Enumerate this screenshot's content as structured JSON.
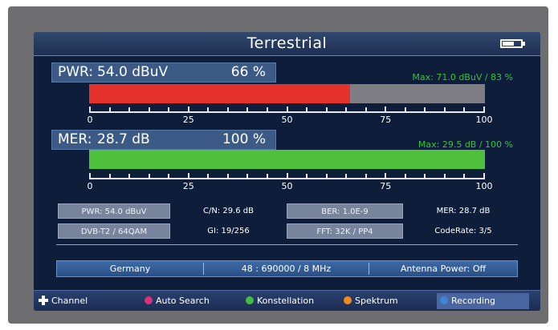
{
  "screen": {
    "title": "Terrestrial"
  },
  "meters": {
    "pwr": {
      "label": "PWR:",
      "value": "54.0 dBuV",
      "percent_text": "66 %",
      "fill_fraction": 0.66,
      "fill_color": "#e4312b",
      "max_text": "Max: 71.0 dBuV / 83 %"
    },
    "mer": {
      "label": "MER:",
      "value": "28.7 dB",
      "percent_text": "100 %",
      "fill_fraction": 1.0,
      "fill_color": "#4ec03c",
      "max_text": "Max: 29.5 dB / 100 %"
    },
    "scale_labels": [
      "0",
      "25",
      "50",
      "75",
      "100"
    ]
  },
  "info": {
    "row1": {
      "pwr": "PWR: 54.0 dBuV",
      "cn": "C/N: 29.6 dB",
      "ber": "BER: 1.0E-9",
      "mer": "MER: 28.7 dB"
    },
    "row2": {
      "standard": "DVB-T2 / 64QAM",
      "gi": "GI: 19/256",
      "fft": "FFT: 32K / PP4",
      "coderate": "CodeRate: 3/5"
    }
  },
  "channel_bar": {
    "country": "Germany",
    "channel": "48 : 690000 / 8 MHz",
    "antenna_power": "Antenna Power: Off"
  },
  "function_keys": [
    {
      "label": "Channel",
      "icon": "dpad-icon",
      "color": "#ffffff"
    },
    {
      "label": "Auto Search",
      "icon": "red-key-icon",
      "color": "#d8327a"
    },
    {
      "label": "Konstellation",
      "icon": "green-key-icon",
      "color": "#3fbf3f"
    },
    {
      "label": "Spektrum",
      "icon": "orange-key-icon",
      "color": "#f08a1c"
    },
    {
      "label": "Recording",
      "icon": "blue-key-icon",
      "color": "#3d86d6"
    }
  ]
}
